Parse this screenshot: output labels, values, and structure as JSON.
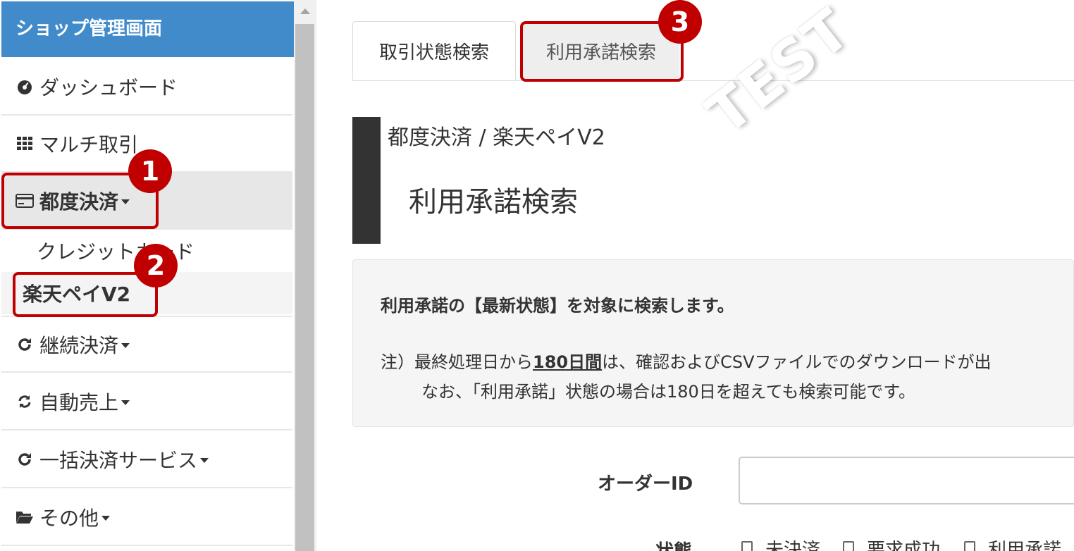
{
  "sidebar": {
    "brand": "ショップ管理画面",
    "items": [
      {
        "label": "ダッシュボード",
        "icon": "dashboard-icon"
      },
      {
        "label": "マルチ取引",
        "icon": "grid-icon"
      },
      {
        "label": "都度決済",
        "icon": "credit-card-icon"
      },
      {
        "label": "継続決済",
        "icon": "refresh-icon"
      },
      {
        "label": "自動売上",
        "icon": "sync-icon"
      },
      {
        "label": "一括決済サービス",
        "icon": "refresh-icon"
      },
      {
        "label": "その他",
        "icon": "folder-open-icon"
      }
    ],
    "subitems": [
      {
        "label": "クレジットカード"
      },
      {
        "label": "楽天ペイV2"
      }
    ]
  },
  "tabs": [
    {
      "label": "取引状態検索"
    },
    {
      "label": "利用承諾検索"
    }
  ],
  "watermark": "TEST",
  "header": {
    "subtitle": "都度決済 / 楽天ペイV2",
    "title": "利用承諾検索"
  },
  "info": {
    "lead": "利用承諾の【最新状態】を対象に検索します。",
    "note1_prefix": "注）最終処理日から",
    "note1_emph": "180日間",
    "note1_suffix": "は、確認およびCSVファイルでのダウンロードが出",
    "note2": "なお、「利用承諾」状態の場合は180日を超えても検索可能です。"
  },
  "form": {
    "order_label": "オーダーID",
    "order_value": "",
    "status_label": "状態",
    "status_options": [
      "未決済",
      "要求成功",
      "利用承諾"
    ]
  },
  "annotations": [
    "1",
    "2",
    "3"
  ],
  "colors": {
    "brand": "#428bca",
    "annotation": "#c00000"
  }
}
